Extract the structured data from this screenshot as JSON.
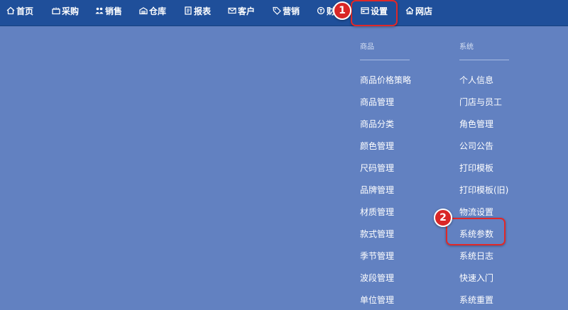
{
  "nav": {
    "items": [
      {
        "label": "首页",
        "icon": "home-icon"
      },
      {
        "label": "采购",
        "icon": "purchase-icon"
      },
      {
        "label": "销售",
        "icon": "sales-icon"
      },
      {
        "label": "仓库",
        "icon": "warehouse-icon"
      },
      {
        "label": "报表",
        "icon": "report-icon"
      },
      {
        "label": "客户",
        "icon": "customer-icon"
      },
      {
        "label": "营销",
        "icon": "marketing-icon"
      },
      {
        "label": "财",
        "icon": "finance-icon"
      },
      {
        "label": "设置",
        "icon": "settings-icon"
      },
      {
        "label": "网店",
        "icon": "shop-icon"
      }
    ],
    "active": "设置"
  },
  "annotations": {
    "step1": "1",
    "step2": "2",
    "color": "#e02828"
  },
  "menu": {
    "goods": {
      "header": "商品",
      "items": [
        "商品价格策略",
        "商品管理",
        "商品分类",
        "颜色管理",
        "尺码管理",
        "品牌管理",
        "材质管理",
        "款式管理",
        "季节管理",
        "波段管理",
        "单位管理"
      ]
    },
    "system": {
      "header": "系统",
      "items": [
        "个人信息",
        "门店与员工",
        "角色管理",
        "公司公告",
        "打印模板",
        "打印模板(旧)",
        "物流设置",
        "系统参数",
        "系统日志",
        "快速入门",
        "系统重置"
      ]
    }
  },
  "colors": {
    "topbar": "#1f4f9a",
    "background": "#6281c1",
    "text": "#ffffff"
  }
}
